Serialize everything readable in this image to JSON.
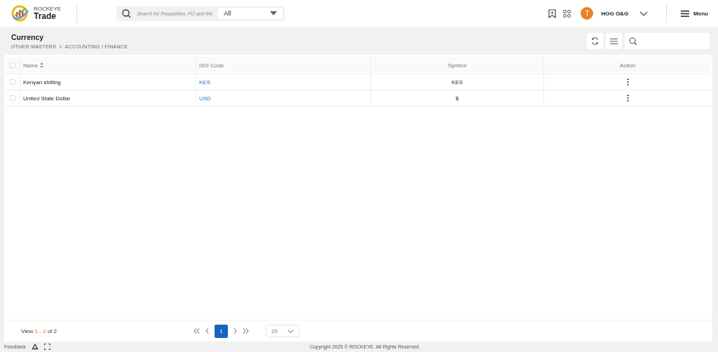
{
  "header": {
    "brand_top": "ROCKEYE",
    "brand_name": "Trade",
    "search": {
      "placeholder": "Search for Requisition, PO and Mo"
    },
    "scope": {
      "value": "All"
    },
    "user": {
      "initial": "T",
      "name": "HOG O&G"
    },
    "menu_label": "Menu"
  },
  "page": {
    "title": "Currency",
    "breadcrumb": [
      {
        "label": "OTHER MASTERS"
      },
      {
        "label": "ACCOUNTING / FINANCE"
      }
    ],
    "breadcrumb_separator": ">"
  },
  "table": {
    "columns": [
      {
        "label": "Name",
        "sortable": true
      },
      {
        "label": "ISO Code"
      },
      {
        "label": "Symbol"
      },
      {
        "label": "Action"
      }
    ],
    "all_checked": false,
    "rows": [
      {
        "checked": false,
        "name": "Kenyan shilling",
        "iso": "KES",
        "symbol": "KES"
      },
      {
        "checked": false,
        "name": "United State Dollar",
        "iso": "USD",
        "symbol": "$"
      }
    ]
  },
  "pagination": {
    "view_label": "View",
    "range": "1 - 2",
    "total": "of 2",
    "pages": [
      {
        "label": "1",
        "selected": true
      }
    ],
    "page_size": "20"
  },
  "footer": {
    "feedback": "Feedback",
    "copyright": "Copyright 2025 © ROCKEYE. All Rights Reserved"
  }
}
